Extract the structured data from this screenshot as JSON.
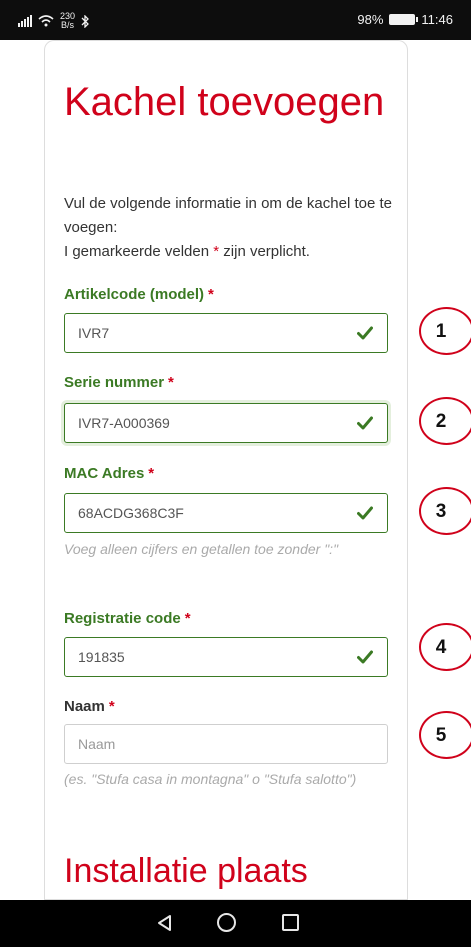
{
  "status_bar": {
    "network_speed": "230",
    "network_speed_unit": "B/s",
    "battery_percent": "98%",
    "time": "11:46"
  },
  "form": {
    "title": "Kachel toevoegen",
    "intro_line1": "Vul de volgende informatie in om de kachel toe te voegen:",
    "intro_line2_pre": "I gemarkeerde velden ",
    "required_mark": "*",
    "intro_line2_post": " zijn verplicht.",
    "fields": [
      {
        "label": "Artikelcode (model)",
        "value": "IVR7",
        "valid": true
      },
      {
        "label": "Serie nummer",
        "value": "IVR7-A000369",
        "valid": true
      },
      {
        "label": "MAC Adres",
        "value": "68ACDG368C3F",
        "valid": true,
        "hint": "Voeg alleen cijfers en getallen toe zonder \":\""
      },
      {
        "label": "Registratie code",
        "value": "191835",
        "valid": true
      },
      {
        "label": "Naam",
        "value": "",
        "placeholder": "Naam",
        "hint": "(es. \"Stufa casa in montagna\" o \"Stufa salotto\")"
      }
    ],
    "section_title": "Installatie plaats"
  },
  "annotations": [
    "1",
    "2",
    "3",
    "4",
    "5"
  ],
  "colors": {
    "accent_red": "#d0021b",
    "label_green": "#3b7a24",
    "check_green": "#3b7a24"
  },
  "icons": {
    "valid": "check-icon",
    "nav_back": "back-triangle-icon",
    "nav_home": "home-circle-icon",
    "nav_recent": "recent-square-icon"
  }
}
